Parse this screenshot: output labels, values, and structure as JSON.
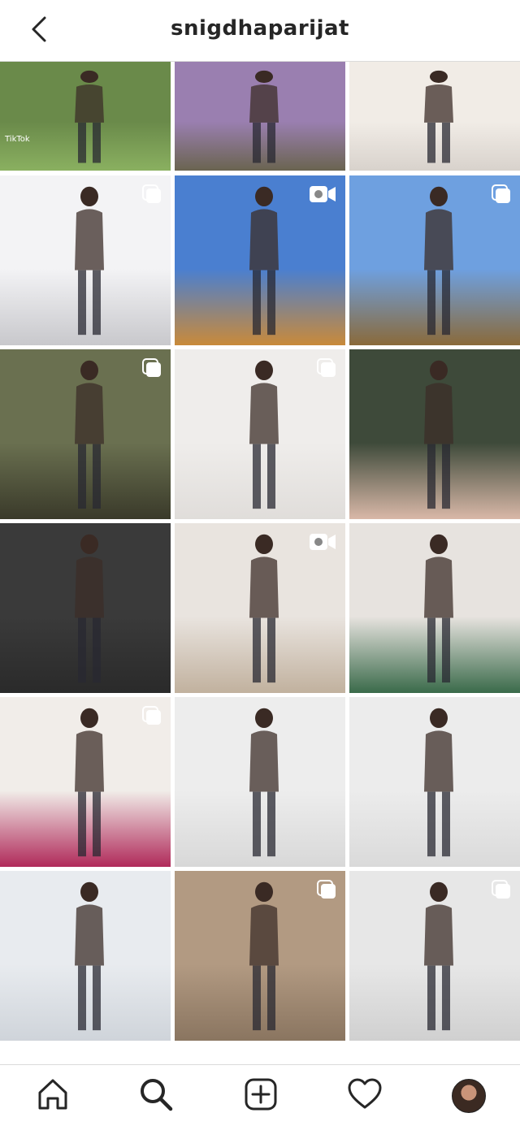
{
  "header": {
    "title": "snigdhaparijat",
    "back_icon": "chevron-left-icon"
  },
  "grid": {
    "tiles": [
      {
        "badge": "none",
        "label": "TikTok",
        "colors": [
          "#6a8a4a",
          "#8ab060"
        ]
      },
      {
        "badge": "none",
        "colors": [
          "#9a7fb0",
          "#6a6450"
        ]
      },
      {
        "badge": "none",
        "colors": [
          "#f1ece6",
          "#d8d2cc"
        ]
      },
      {
        "badge": "multi",
        "colors": [
          "#f3f3f5",
          "#c8c8cc"
        ]
      },
      {
        "badge": "video",
        "colors": [
          "#4a7fd0",
          "#c98a3a"
        ]
      },
      {
        "badge": "multi",
        "colors": [
          "#6ea0e0",
          "#8a6a3a"
        ]
      },
      {
        "badge": "multi",
        "colors": [
          "#6a7050",
          "#3a3a2a"
        ]
      },
      {
        "badge": "multi",
        "colors": [
          "#efedeb",
          "#e0ddda"
        ]
      },
      {
        "badge": "none",
        "colors": [
          "#3e4a3a",
          "#d9b8a8"
        ]
      },
      {
        "badge": "none",
        "colors": [
          "#3a3a3a",
          "#2a2a2a"
        ]
      },
      {
        "badge": "video",
        "colors": [
          "#e9e4df",
          "#c1b19e"
        ]
      },
      {
        "badge": "none",
        "colors": [
          "#e7e3df",
          "#3a6a4a"
        ]
      },
      {
        "badge": "multi",
        "colors": [
          "#f1ede9",
          "#b02a5a"
        ]
      },
      {
        "badge": "none",
        "colors": [
          "#ededed",
          "#d8d8d8"
        ]
      },
      {
        "badge": "none",
        "colors": [
          "#ececec",
          "#dadada"
        ]
      },
      {
        "badge": "none",
        "colors": [
          "#e8ebef",
          "#cfd4da"
        ]
      },
      {
        "badge": "multi",
        "colors": [
          "#b29a82",
          "#8a7560"
        ]
      },
      {
        "badge": "multi",
        "colors": [
          "#e7e7e7",
          "#d0d0d0"
        ]
      }
    ],
    "tiktok_caption": "TikTok"
  },
  "tabbar": {
    "items": [
      {
        "name": "home",
        "icon": "home-icon"
      },
      {
        "name": "search",
        "icon": "search-icon"
      },
      {
        "name": "new-post",
        "icon": "plus-square-icon"
      },
      {
        "name": "activity",
        "icon": "heart-icon"
      },
      {
        "name": "profile",
        "icon": "avatar"
      }
    ]
  },
  "accent": "#262626"
}
